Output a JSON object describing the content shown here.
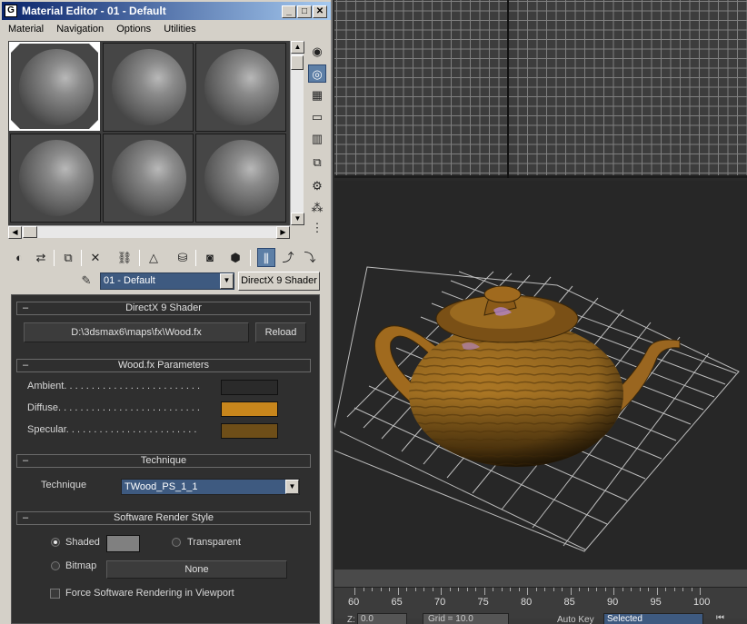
{
  "window": {
    "title": "Material Editor - 01 - Default",
    "app_icon": "G",
    "buttons": [
      "_",
      "□",
      "✕"
    ]
  },
  "menu": [
    "Material",
    "Navigation",
    "Options",
    "Utilities"
  ],
  "material_name": "01 - Default",
  "shader_button": "DirectX 9 Shader",
  "rollouts": {
    "dx9": {
      "title": "DirectX 9 Shader",
      "path": "D:\\3dsmax6\\maps\\fx\\Wood.fx",
      "reload": "Reload"
    },
    "params": {
      "title": "Wood.fx Parameters",
      "ambient_label": "Ambient. . . . . . . . . . . . . . . . . . . . . . . . .",
      "diffuse_label": "Diffuse. . . . . . . . . . . . . . . . . . . . . . . . . .",
      "specular_label": "Specular. . . . . . . . . . . . . . . . . . . . . . . .",
      "ambient_color": "#2a2a2a",
      "diffuse_color": "#c8861c",
      "specular_color": "#6e4e18"
    },
    "technique": {
      "title": "Technique",
      "label": "Technique",
      "value": "TWood_PS_1_1"
    },
    "render_style": {
      "title": "Software Render Style",
      "shaded": "Shaded",
      "transparent": "Transparent",
      "bitmap": "Bitmap",
      "bitmap_value": "None",
      "force_sw": "Force Software Rendering in Viewport",
      "shaded_swatch": "#808080"
    }
  },
  "timeline": {
    "ticks": [
      "60",
      "65",
      "70",
      "75",
      "80",
      "85",
      "90",
      "95",
      "100"
    ]
  },
  "bottom": {
    "z_label": "Z:",
    "z_value": "0.0",
    "grid": "Grid = 10.0",
    "autokey": "Auto Key",
    "selected": "Selected"
  }
}
